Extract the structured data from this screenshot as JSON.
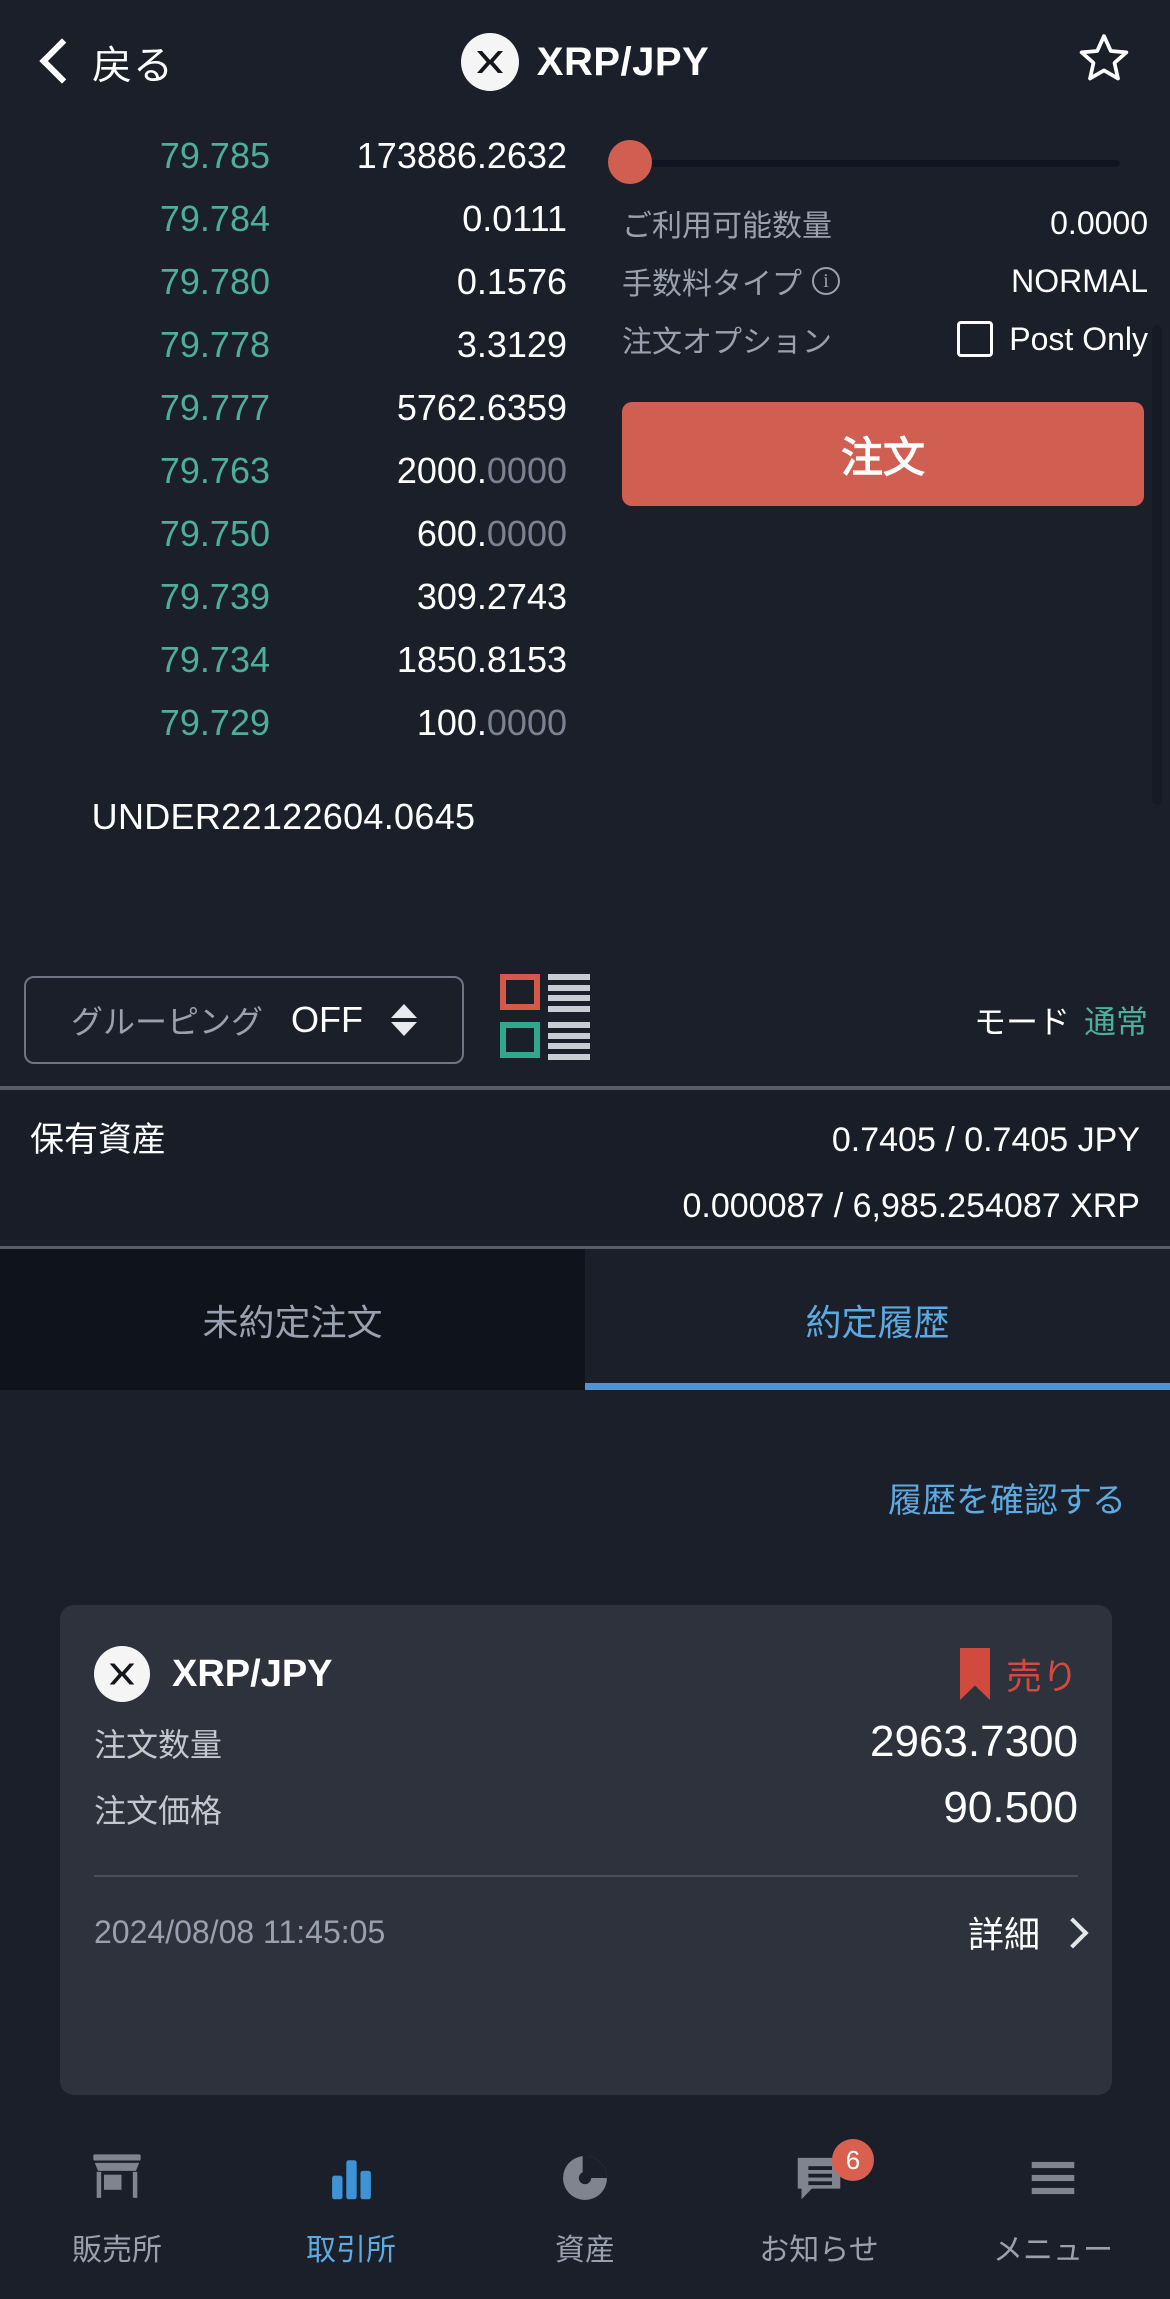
{
  "header": {
    "back_label": "戻る",
    "pair": "XRP/JPY",
    "back_icon": "chevron-left-icon",
    "coin_icon": "xrp-logo-icon",
    "star_icon": "star-outline-icon"
  },
  "orderbook": {
    "rows": [
      {
        "price": "79.785",
        "amount_main": "173886.2632",
        "amount_dim": ""
      },
      {
        "price": "79.784",
        "amount_main": "0.0111",
        "amount_dim": ""
      },
      {
        "price": "79.780",
        "amount_main": "0.1576",
        "amount_dim": ""
      },
      {
        "price": "79.778",
        "amount_main": "3.3129",
        "amount_dim": ""
      },
      {
        "price": "79.777",
        "amount_main": "5762.6359",
        "amount_dim": ""
      },
      {
        "price": "79.763",
        "amount_main": "2000.",
        "amount_dim": "0000"
      },
      {
        "price": "79.750",
        "amount_main": "600.",
        "amount_dim": "0000"
      },
      {
        "price": "79.739",
        "amount_main": "309.2743",
        "amount_dim": ""
      },
      {
        "price": "79.734",
        "amount_main": "1850.8153",
        "amount_dim": ""
      },
      {
        "price": "79.729",
        "amount_main": "100.",
        "amount_dim": "0000"
      }
    ],
    "under_label": "UNDER",
    "under_value": "22122604.0645"
  },
  "order_panel": {
    "slider_value": "0",
    "available_label": "ご利用可能数量",
    "available_value": "0.0000",
    "fee_type_label": "手数料タイプ",
    "fee_type_value": "NORMAL",
    "fee_info_icon": "info-icon",
    "option_label": "注文オプション",
    "post_only_label": "Post Only",
    "post_only_checked": "false",
    "submit_label": "注文"
  },
  "grouping": {
    "label": "グルーピング",
    "value": "OFF",
    "stepper_icon": "up-down-arrows-icon",
    "layout_toggle_icon": "orderbook-layout-icon",
    "mode_label": "モード",
    "mode_value": "通常"
  },
  "holdings": {
    "title": "保有資産",
    "jpy": "0.7405 / 0.7405  JPY",
    "xrp": "0.000087 / 6,985.254087  XRP"
  },
  "tabs": [
    {
      "label": "未約定注文",
      "active": "false"
    },
    {
      "label": "約定履歴",
      "active": "true"
    }
  ],
  "history": {
    "link_label": "履歴を確認する",
    "card": {
      "pair": "XRP/JPY",
      "coin_icon": "xrp-logo-icon",
      "side_icon": "bookmark-icon",
      "side_label": "売り",
      "rows": [
        {
          "label": "注文数量",
          "value": "2963.7300"
        },
        {
          "label": "注文価格",
          "value": "90.500"
        }
      ],
      "timestamp": "2024/08/08 11:45:05",
      "detail_label": "詳細",
      "detail_icon": "chevron-right-icon"
    }
  },
  "bottom_nav": [
    {
      "label": "販売所",
      "icon": "store-icon",
      "active": "false",
      "badge": ""
    },
    {
      "label": "取引所",
      "icon": "bar-chart-icon",
      "active": "true",
      "badge": ""
    },
    {
      "label": "資産",
      "icon": "pie-chart-icon",
      "active": "false",
      "badge": ""
    },
    {
      "label": "お知らせ",
      "icon": "chat-bubble-icon",
      "active": "false",
      "badge": "6"
    },
    {
      "label": "メニュー",
      "icon": "hamburger-menu-icon",
      "active": "false",
      "badge": ""
    }
  ],
  "colors": {
    "bg": "#1b1f2a",
    "accent_red": "#d15f51",
    "accent_blue": "#5da9e0",
    "accent_green": "#4eae99"
  }
}
